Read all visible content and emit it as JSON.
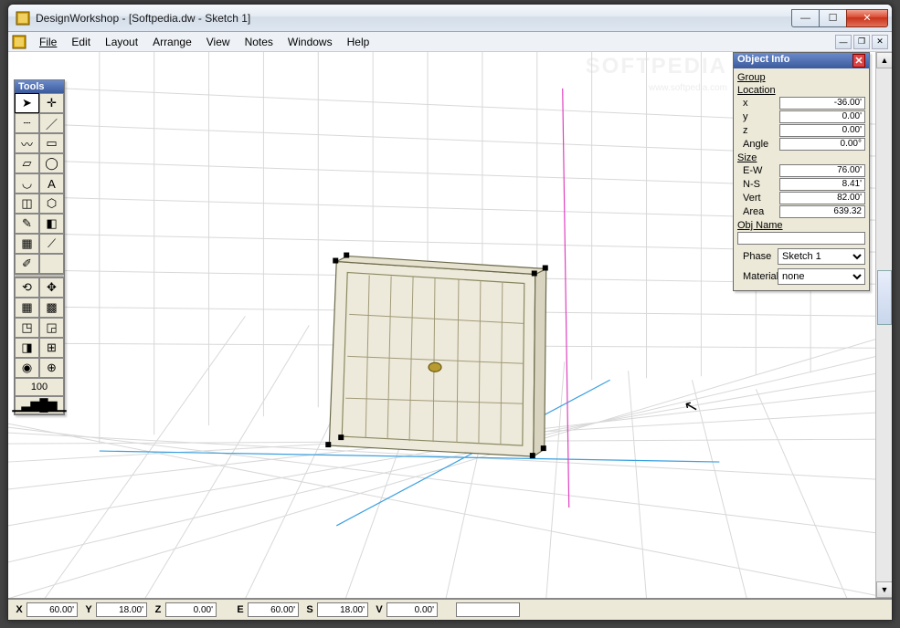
{
  "title": "DesignWorkshop - [Softpedia.dw - Sketch 1]",
  "menu": [
    "File",
    "Edit",
    "Layout",
    "Arrange",
    "View",
    "Notes",
    "Windows",
    "Help"
  ],
  "tools_title": "Tools",
  "tool_value": "100",
  "object_info": {
    "title": "Object Info",
    "group": "Group",
    "location_label": "Location",
    "x_label": "x",
    "x_val": "-36.00'",
    "y_label": "y",
    "y_val": "0.00'",
    "z_label": "z",
    "z_val": "0.00'",
    "angle_label": "Angle",
    "angle_val": "0.00°",
    "size_label": "Size",
    "ew_label": "E-W",
    "ew_val": "76.00'",
    "ns_label": "N-S",
    "ns_val": "8.41'",
    "vert_label": "Vert",
    "vert_val": "82.00'",
    "area_label": "Area",
    "area_val": "639.32",
    "objname_label": "Obj Name",
    "objname_val": "",
    "phase_label": "Phase",
    "phase_val": "Sketch 1",
    "material_label": "Material",
    "material_val": "none"
  },
  "status": {
    "X": "60.00'",
    "Y": "18.00'",
    "Z": "0.00'",
    "E": "60.00'",
    "S": "18.00'",
    "V": "0.00'",
    "blank": ""
  },
  "watermark": "SOFTPEDIA",
  "watermark_sub": "www.softpedia.com"
}
